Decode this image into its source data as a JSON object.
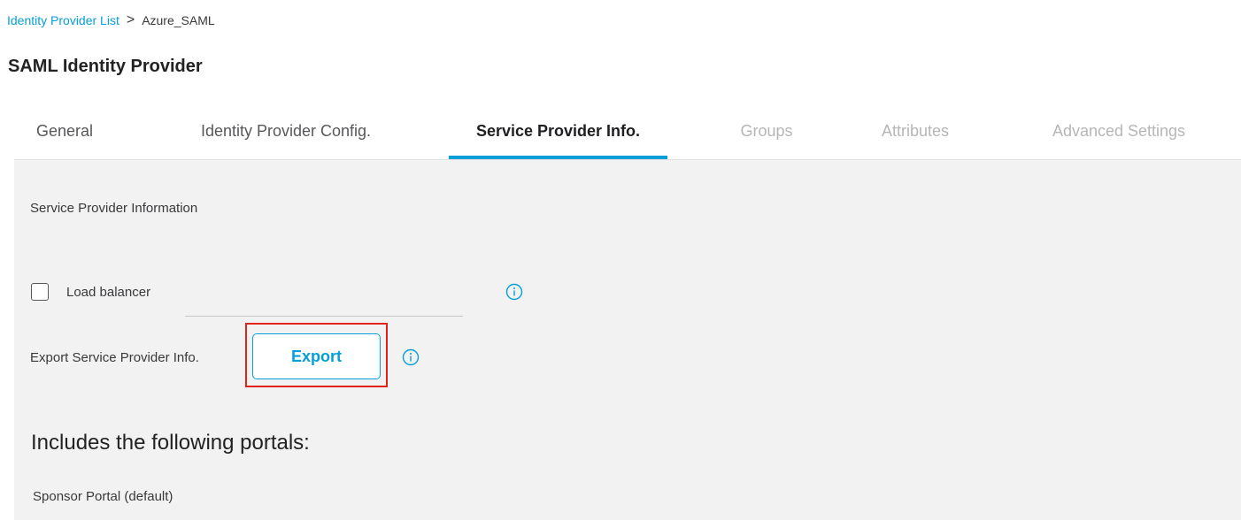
{
  "breadcrumb": {
    "parent": "Identity Provider List",
    "separator": ">",
    "current": "Azure_SAML"
  },
  "page": {
    "title": "SAML Identity Provider"
  },
  "tabs": [
    {
      "label": "General",
      "state": "enabled"
    },
    {
      "label": "Identity Provider Config.",
      "state": "enabled"
    },
    {
      "label": "Service Provider Info.",
      "state": "active"
    },
    {
      "label": "Groups",
      "state": "disabled"
    },
    {
      "label": "Attributes",
      "state": "disabled"
    },
    {
      "label": "Advanced Settings",
      "state": "disabled"
    }
  ],
  "panel": {
    "section_label": "Service Provider Information",
    "load_balancer": {
      "label": "Load balancer",
      "checked": false,
      "value": ""
    },
    "export": {
      "label": "Export Service Provider Info.",
      "button_label": "Export"
    },
    "portals": {
      "heading": "Includes the following portals:",
      "items": [
        "Sponsor Portal (default)"
      ]
    }
  },
  "colors": {
    "accent": "#049fd9",
    "highlight": "#e2231a",
    "panel_bg": "#f2f2f2"
  },
  "icons": [
    "info-icon"
  ]
}
